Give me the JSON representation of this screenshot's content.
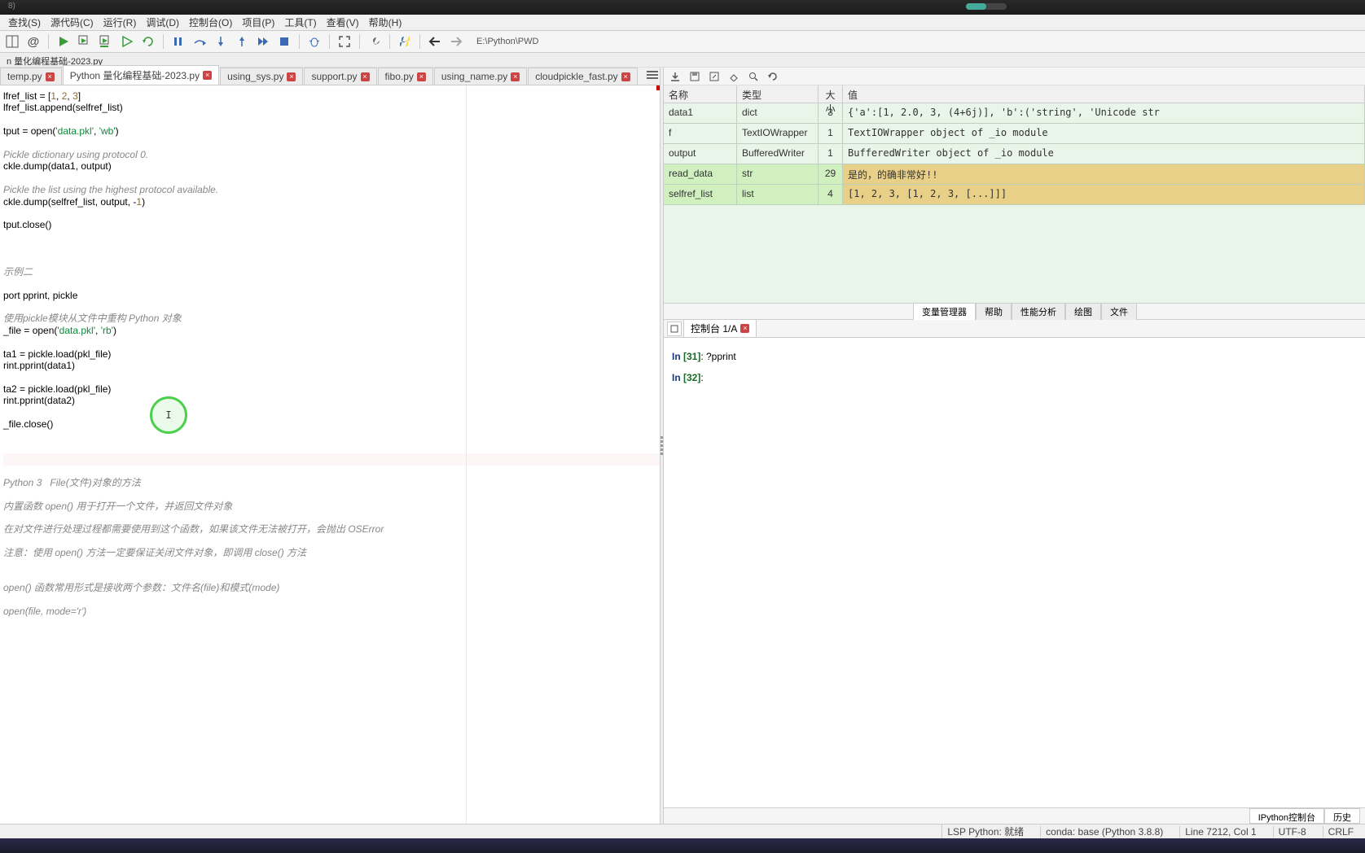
{
  "window": {
    "time_label": "8)"
  },
  "menu": {
    "items": [
      "查找(S)",
      "源代码(C)",
      "运行(R)",
      "调试(D)",
      "控制台(O)",
      "项目(P)",
      "工具(T)",
      "查看(V)",
      "帮助(H)"
    ]
  },
  "toolbar": {
    "path": "E:\\Python\\PWD"
  },
  "breadcrumb": "n 量化编程基础-2023.py",
  "editor": {
    "tabs": [
      {
        "label": "temp.py",
        "active": false
      },
      {
        "label": "Python 量化编程基础-2023.py",
        "active": true
      },
      {
        "label": "using_sys.py",
        "active": false
      },
      {
        "label": "support.py",
        "active": false
      },
      {
        "label": "fibo.py",
        "active": false
      },
      {
        "label": "using_name.py",
        "active": false
      },
      {
        "label": "cloudpickle_fast.py",
        "active": false
      }
    ],
    "code_html": "lfref_list = [<span class='tok-n'>1</span>, <span class='tok-n'>2</span>, <span class='tok-n'>3</span>]\nlfref_list.append(selfref_list)\n\ntput = open(<span class='tok-s'>'data.pkl'</span>, <span class='tok-s'>'wb'</span>)\n\n<span class='tok-c'>Pickle dictionary using protocol 0.</span>\nckle.dump(data1, output)\n\n<span class='tok-c'>Pickle the list using the highest protocol available.</span>\nckle.dump(selfref_list, output, -<span class='tok-n'>1</span>)\n\ntput.close()\n\n\n\n<span class='tok-c'>示例二</span>\n\nport pprint, pickle\n\n<span class='tok-c'>使用pickle模块从文件中重构 Python 对象</span>\n_file = open(<span class='tok-s'>'data.pkl'</span>, <span class='tok-s'>'rb'</span>)\n\nta1 = pickle.load(pkl_file)\nrint.pprint(data1)\n\nta2 = pickle.load(pkl_file)\nrint.pprint(data2)\n\n_file.close()\n\n\n<div class='highlight-block'> </div>\n\n<span class='tok-c'>Python 3   File(文件)对象的方法</span>\n\n<span class='tok-c'>内置函数 open() 用于打开一个文件，并返回文件对象</span>\n\n<span class='tok-c'>在对文件进行处理过程都需要使用到这个函数，如果该文件无法被打开，会抛出 OSError</span>\n\n<span class='tok-c'>注意：使用 open() 方法一定要保证关闭文件对象，即调用 close() 方法</span>\n\n\n<span class='tok-c'>open() 函数常用形式是接收两个参数：文件名(file)和模式(mode)</span>\n\n<span class='tok-c'>open(file, mode='r')</span>"
  },
  "var_explorer": {
    "headers": {
      "name": "名称",
      "type": "类型",
      "size": "大小",
      "value": "值"
    },
    "rows": [
      {
        "name": "data1",
        "type": "dict",
        "size": "3",
        "value": "{'a':[1, 2.0, 3, (4+6j)], 'b':('string', 'Unicode str",
        "hl": false
      },
      {
        "name": "f",
        "type": "TextIOWrapper",
        "size": "1",
        "value": "TextIOWrapper object of _io module",
        "hl": false
      },
      {
        "name": "output",
        "type": "BufferedWriter",
        "size": "1",
        "value": "BufferedWriter object of _io module",
        "hl": false
      },
      {
        "name": "read_data",
        "type": "str",
        "size": "29",
        "value": "是的，的确非常好!!",
        "hl": true
      },
      {
        "name": "selfref_list",
        "type": "list",
        "size": "4",
        "value": "[1, 2, 3, [1, 2, 3, [...]]]",
        "hl": true
      }
    ],
    "panel_tabs": [
      "变量管理器",
      "帮助",
      "性能分析",
      "绘图",
      "文件"
    ]
  },
  "console": {
    "tab_label": "控制台 1/A",
    "lines": [
      {
        "prompt": "In ",
        "num": "[31]",
        "text": ": ?pprint"
      },
      {
        "prompt": "In ",
        "num": "[32]",
        "text": ":"
      }
    ],
    "bottom_tabs": [
      "IPython控制台",
      "历史"
    ]
  },
  "status": {
    "lsp": "LSP Python: 就绪",
    "conda": "conda: base (Python 3.8.8)",
    "line": "Line 7212, Col 1",
    "encoding": "UTF-8",
    "eol": "CRLF",
    "perm": ""
  }
}
